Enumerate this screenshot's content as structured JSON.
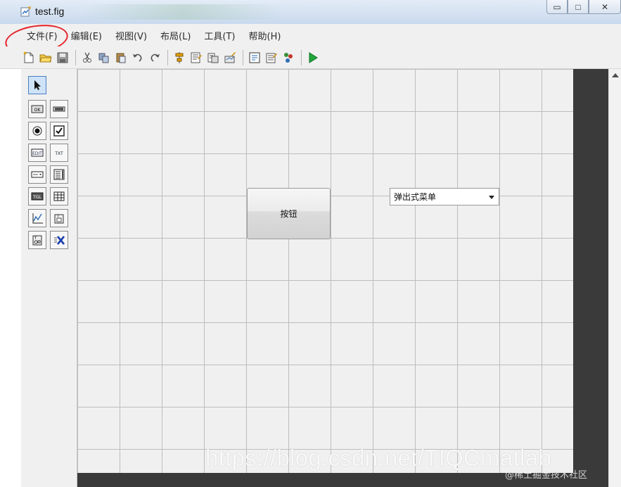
{
  "window": {
    "title": "test.fig",
    "controls": [
      "minimize-icon",
      "maximize-icon",
      "close-icon"
    ]
  },
  "menubar": {
    "items": [
      {
        "label": "文件(F)"
      },
      {
        "label": "编辑(E)"
      },
      {
        "label": "视图(V)"
      },
      {
        "label": "布局(L)"
      },
      {
        "label": "工具(T)"
      },
      {
        "label": "帮助(H)"
      }
    ]
  },
  "toolbar": {
    "icons": [
      "new-file-icon",
      "open-folder-icon",
      "save-icon",
      "cut-icon",
      "copy-icon",
      "paste-icon",
      "undo-icon",
      "redo-icon",
      "align-icon",
      "menu-editor-icon",
      "tab-order-icon",
      "toolbar-editor-icon",
      "editor-icon",
      "property-inspector-icon",
      "object-browser-icon",
      "run-icon"
    ]
  },
  "palette": {
    "tools": [
      "select-arrow-icon",
      "push-button-icon",
      "slider-icon",
      "radio-button-icon",
      "checkbox-icon",
      "edit-text-icon",
      "static-text-icon",
      "popup-menu-icon",
      "listbox-icon",
      "toggle-button-icon",
      "table-icon",
      "axes-icon",
      "panel-icon",
      "button-group-icon",
      "activex-icon"
    ]
  },
  "canvas": {
    "push_button": {
      "label": "按钮"
    },
    "popup_menu": {
      "label": "弹出式菜单"
    }
  },
  "watermark": {
    "url": "https://blog.csdn.net/TIQCmatlab",
    "credit": "@稀土掘金技术社区"
  },
  "colors": {
    "annotation": "#e5232a",
    "grid_line": "#bdbdbd",
    "canvas_bg": "#f0f0f0",
    "dark_area": "#3a3a3a",
    "run_green": "#1fa83a"
  }
}
